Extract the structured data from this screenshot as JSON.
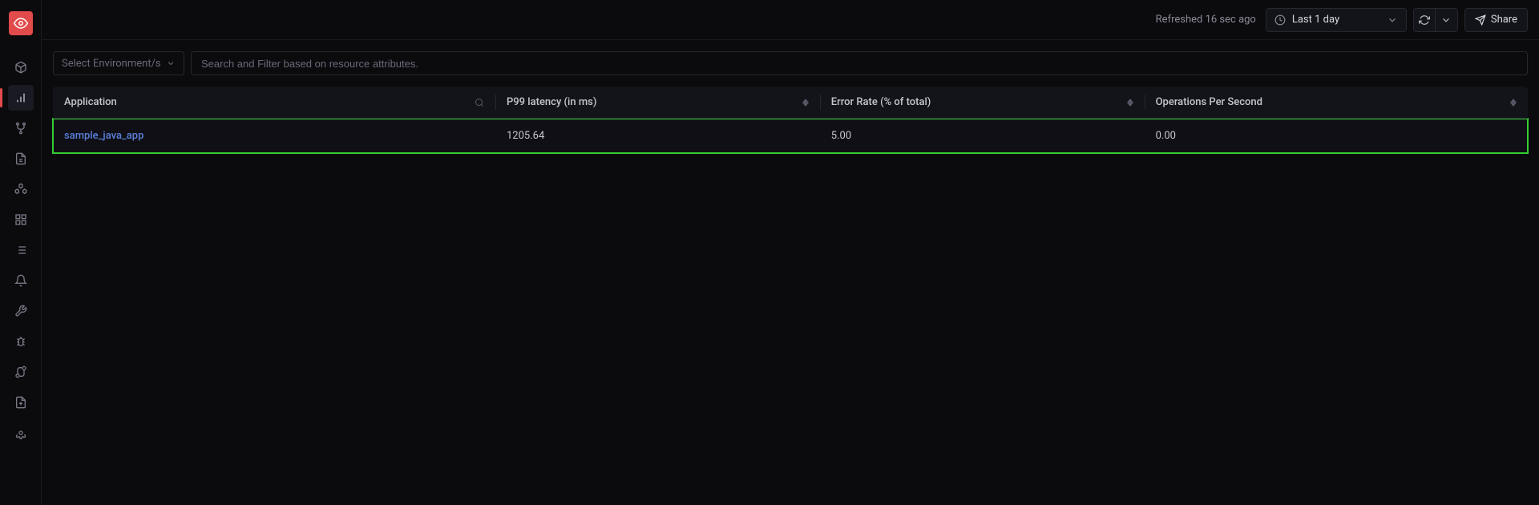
{
  "topbar": {
    "refreshed_text": "Refreshed 16 sec ago",
    "time_range_label": "Last 1 day",
    "share_label": "Share"
  },
  "filters": {
    "env_placeholder": "Select Environment/s",
    "search_placeholder": "Search and Filter based on resource attributes."
  },
  "table": {
    "headers": {
      "application": "Application",
      "p99": "P99 latency (in ms)",
      "error_rate": "Error Rate (% of total)",
      "ops": "Operations Per Second"
    },
    "rows": [
      {
        "application": "sample_java_app",
        "p99": "1205.64",
        "error_rate": "5.00",
        "ops": "0.00"
      }
    ]
  },
  "colors": {
    "accent": "#e24b4b",
    "highlight": "#33cc33",
    "link": "#5b7fd9"
  }
}
